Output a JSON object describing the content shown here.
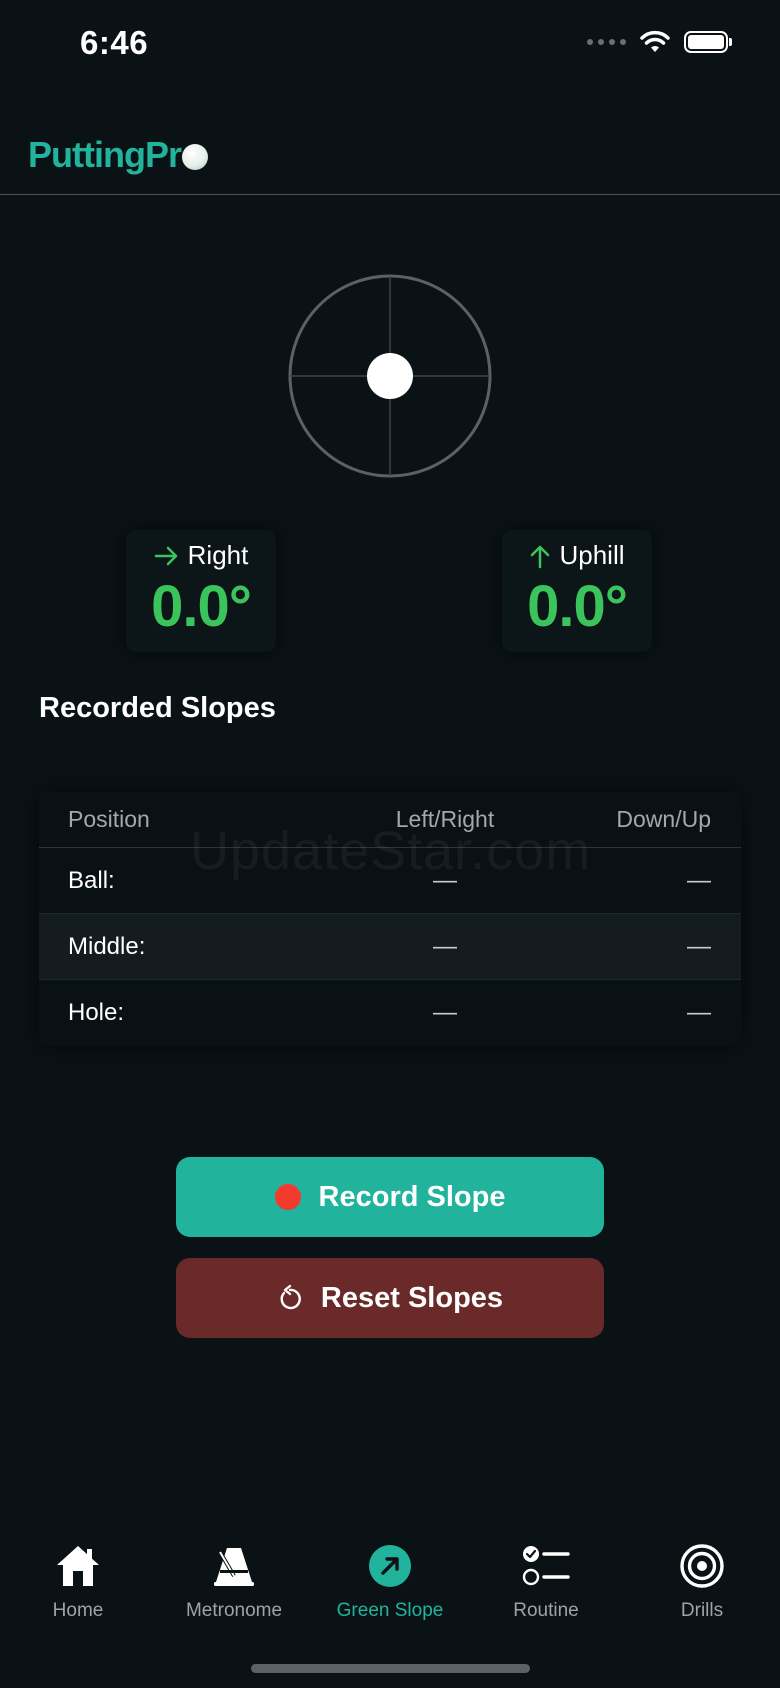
{
  "status_bar": {
    "time": "6:46"
  },
  "header": {
    "app_name": "PuttingPr"
  },
  "readouts": {
    "left": {
      "direction": "Right",
      "value": "0.0°"
    },
    "right": {
      "direction": "Uphill",
      "value": "0.0°"
    }
  },
  "recorded": {
    "title": "Recorded Slopes",
    "columns": [
      "Position",
      "Left/Right",
      "Down/Up"
    ],
    "rows": [
      {
        "position": "Ball:",
        "left_right": "—",
        "down_up": "—"
      },
      {
        "position": "Middle:",
        "left_right": "—",
        "down_up": "—"
      },
      {
        "position": "Hole:",
        "left_right": "—",
        "down_up": "—"
      }
    ]
  },
  "watermark": "UpdateStar.com",
  "buttons": {
    "record": "Record Slope",
    "reset": "Reset Slopes"
  },
  "tabs": [
    {
      "label": "Home",
      "icon": "house-icon"
    },
    {
      "label": "Metronome",
      "icon": "metronome-icon"
    },
    {
      "label": "Green Slope",
      "icon": "slope-arrow-icon",
      "active": true
    },
    {
      "label": "Routine",
      "icon": "checklist-icon"
    },
    {
      "label": "Drills",
      "icon": "target-icon"
    }
  ],
  "colors": {
    "accent": "#22b39d",
    "value_green": "#3cc45c",
    "reset_red": "#6b2a2a",
    "record_dot": "#f23b2e",
    "background": "#0a1215"
  }
}
